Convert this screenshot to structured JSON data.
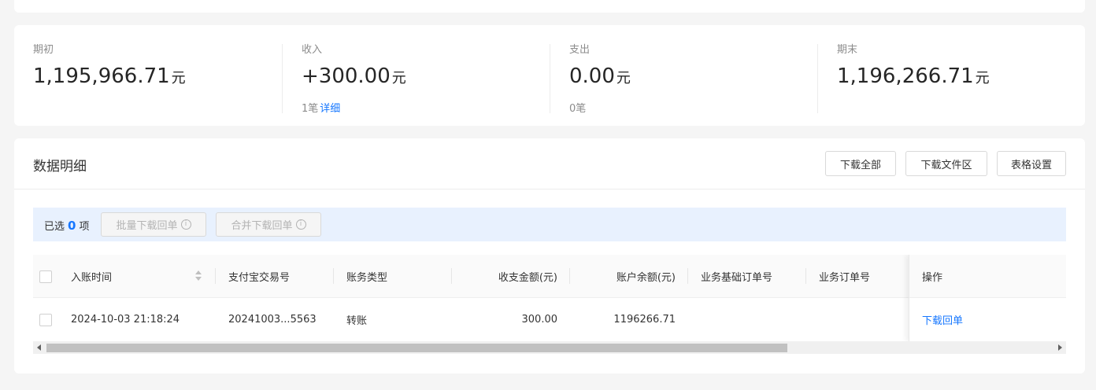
{
  "summary": {
    "opening": {
      "label": "期初",
      "value": "1,195,966.71",
      "unit": "元"
    },
    "income": {
      "label": "收入",
      "value": "+300.00",
      "unit": "元",
      "count": "1笔",
      "detail_link": "详细"
    },
    "expense": {
      "label": "支出",
      "value": "0.00",
      "unit": "元",
      "count": "0笔"
    },
    "closing": {
      "label": "期末",
      "value": "1,196,266.71",
      "unit": "元"
    }
  },
  "detail": {
    "title": "数据明细",
    "buttons": {
      "download_all": "下载全部",
      "download_area": "下载文件区",
      "table_settings": "表格设置"
    },
    "selection": {
      "prefix": "已选",
      "count": "0",
      "suffix": "项",
      "batch_download": "批量下载回单",
      "merge_download": "合并下载回单"
    },
    "table": {
      "columns": {
        "time": "入账时间",
        "trade_no": "支付宝交易号",
        "type": "账务类型",
        "amount": "收支金额(元)",
        "balance": "账户余额(元)",
        "base_order": "业务基础订单号",
        "order": "业务订单号",
        "action": "操作"
      },
      "rows": [
        {
          "time": "2024-10-03 21:18:24",
          "trade_no": "20241003...5563",
          "type": "转账",
          "amount": "300.00",
          "balance": "1196266.71",
          "base_order": "",
          "order": "",
          "action": "下载回单"
        }
      ]
    }
  },
  "colors": {
    "accent": "#1677ff",
    "selection_bg": "#e8f1fe",
    "page_bg": "#f5f5f5"
  }
}
